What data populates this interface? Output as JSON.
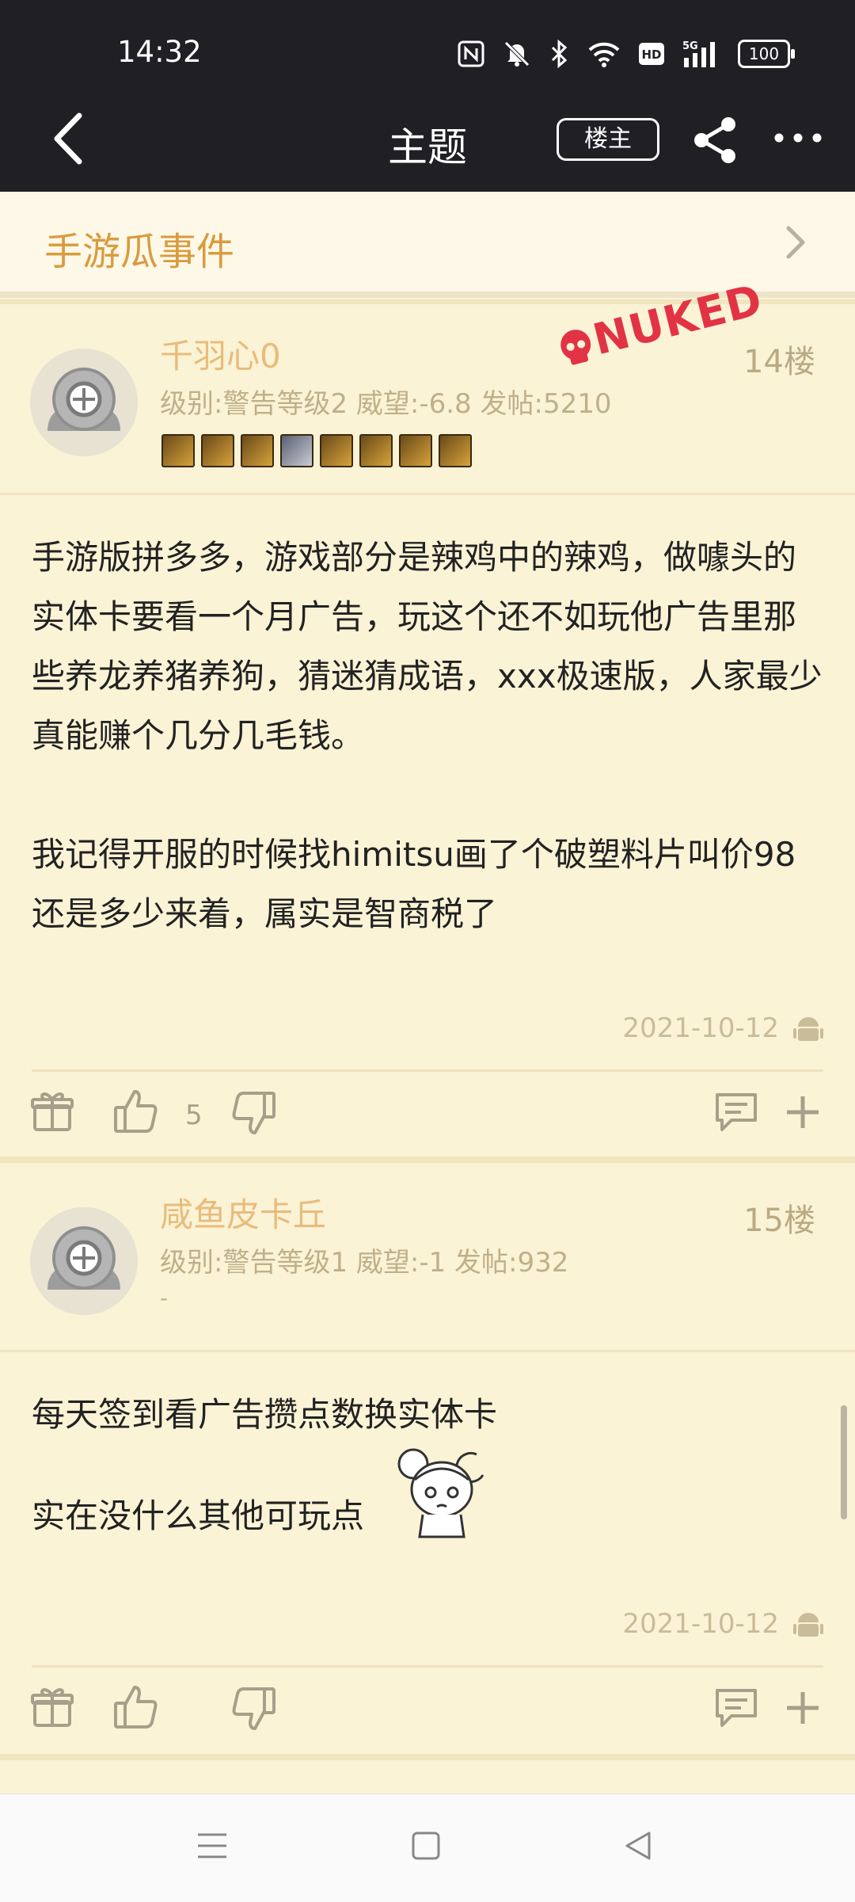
{
  "status_bar": {
    "time": "14:32",
    "battery": "100",
    "icons": [
      "nfc-icon",
      "mute-icon",
      "bluetooth-icon",
      "wifi-icon",
      "hd-icon",
      "signal-5g-icon",
      "battery-icon"
    ]
  },
  "header": {
    "title": "主题",
    "op_label": "楼主"
  },
  "board": {
    "name": "手游瓜事件"
  },
  "posts": [
    {
      "username": "千羽心0",
      "floor": "14楼",
      "meta": "级别:警告等级2 威望:-6.8 发帖:5210",
      "stamp": "NUKED",
      "content": "手游版拼多多，游戏部分是辣鸡中的辣鸡，做噱头的实体卡要看一个月广告，玩这个还不如玩他广告里那些养龙养猪养狗，猜迷猜成语，xxx极速版，人家最少真能赚个几分几毛钱。\n\n我记得开服的时候找himitsu画了个破塑料片叫价98还是多少来着，属实是智商税了",
      "date": "2021-10-12",
      "likes": "5"
    },
    {
      "username": "咸鱼皮卡丘",
      "floor": "15楼",
      "meta": "级别:警告等级1 威望:-1 发帖:932",
      "signature": "-",
      "content_line1": "每天签到看广告攒点数换实体卡",
      "content_line2": "实在没什么其他可玩点",
      "date": "2021-10-12"
    }
  ],
  "colors": {
    "header_bg": "#1f1f24",
    "page_bg": "#fbf3d6",
    "accent": "#d89c3f",
    "nuked": "#e23345"
  }
}
